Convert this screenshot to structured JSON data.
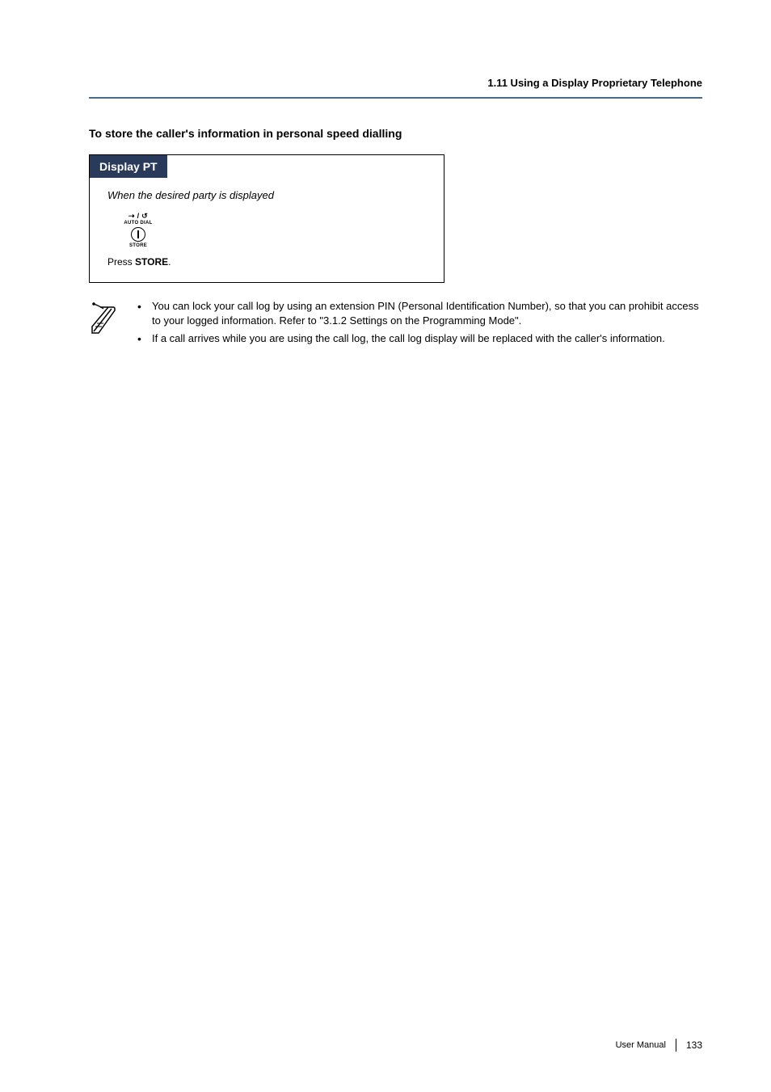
{
  "header": {
    "breadcrumb": "1.11 Using a Display Proprietary Telephone"
  },
  "section": {
    "title": "To store the caller's information in personal speed dialling"
  },
  "procedure": {
    "tab_label": "Display PT",
    "subtitle": "When the desired party is displayed",
    "button": {
      "top_glyph": "⇢ / ↺",
      "top_label": "AUTO DIAL",
      "bottom_label": "STORE"
    },
    "instruction_prefix": "Press ",
    "instruction_bold": "STORE",
    "instruction_suffix": "."
  },
  "notes": {
    "items": [
      "You can lock your call log by using an extension PIN (Personal Identification Number), so that you can prohibit access to your logged information. Refer to \"3.1.2 Settings on the Programming Mode\".",
      "If a call arrives while you are using the call log, the call log display will be replaced with the caller's information."
    ]
  },
  "footer": {
    "label": "User Manual",
    "page": "133"
  }
}
